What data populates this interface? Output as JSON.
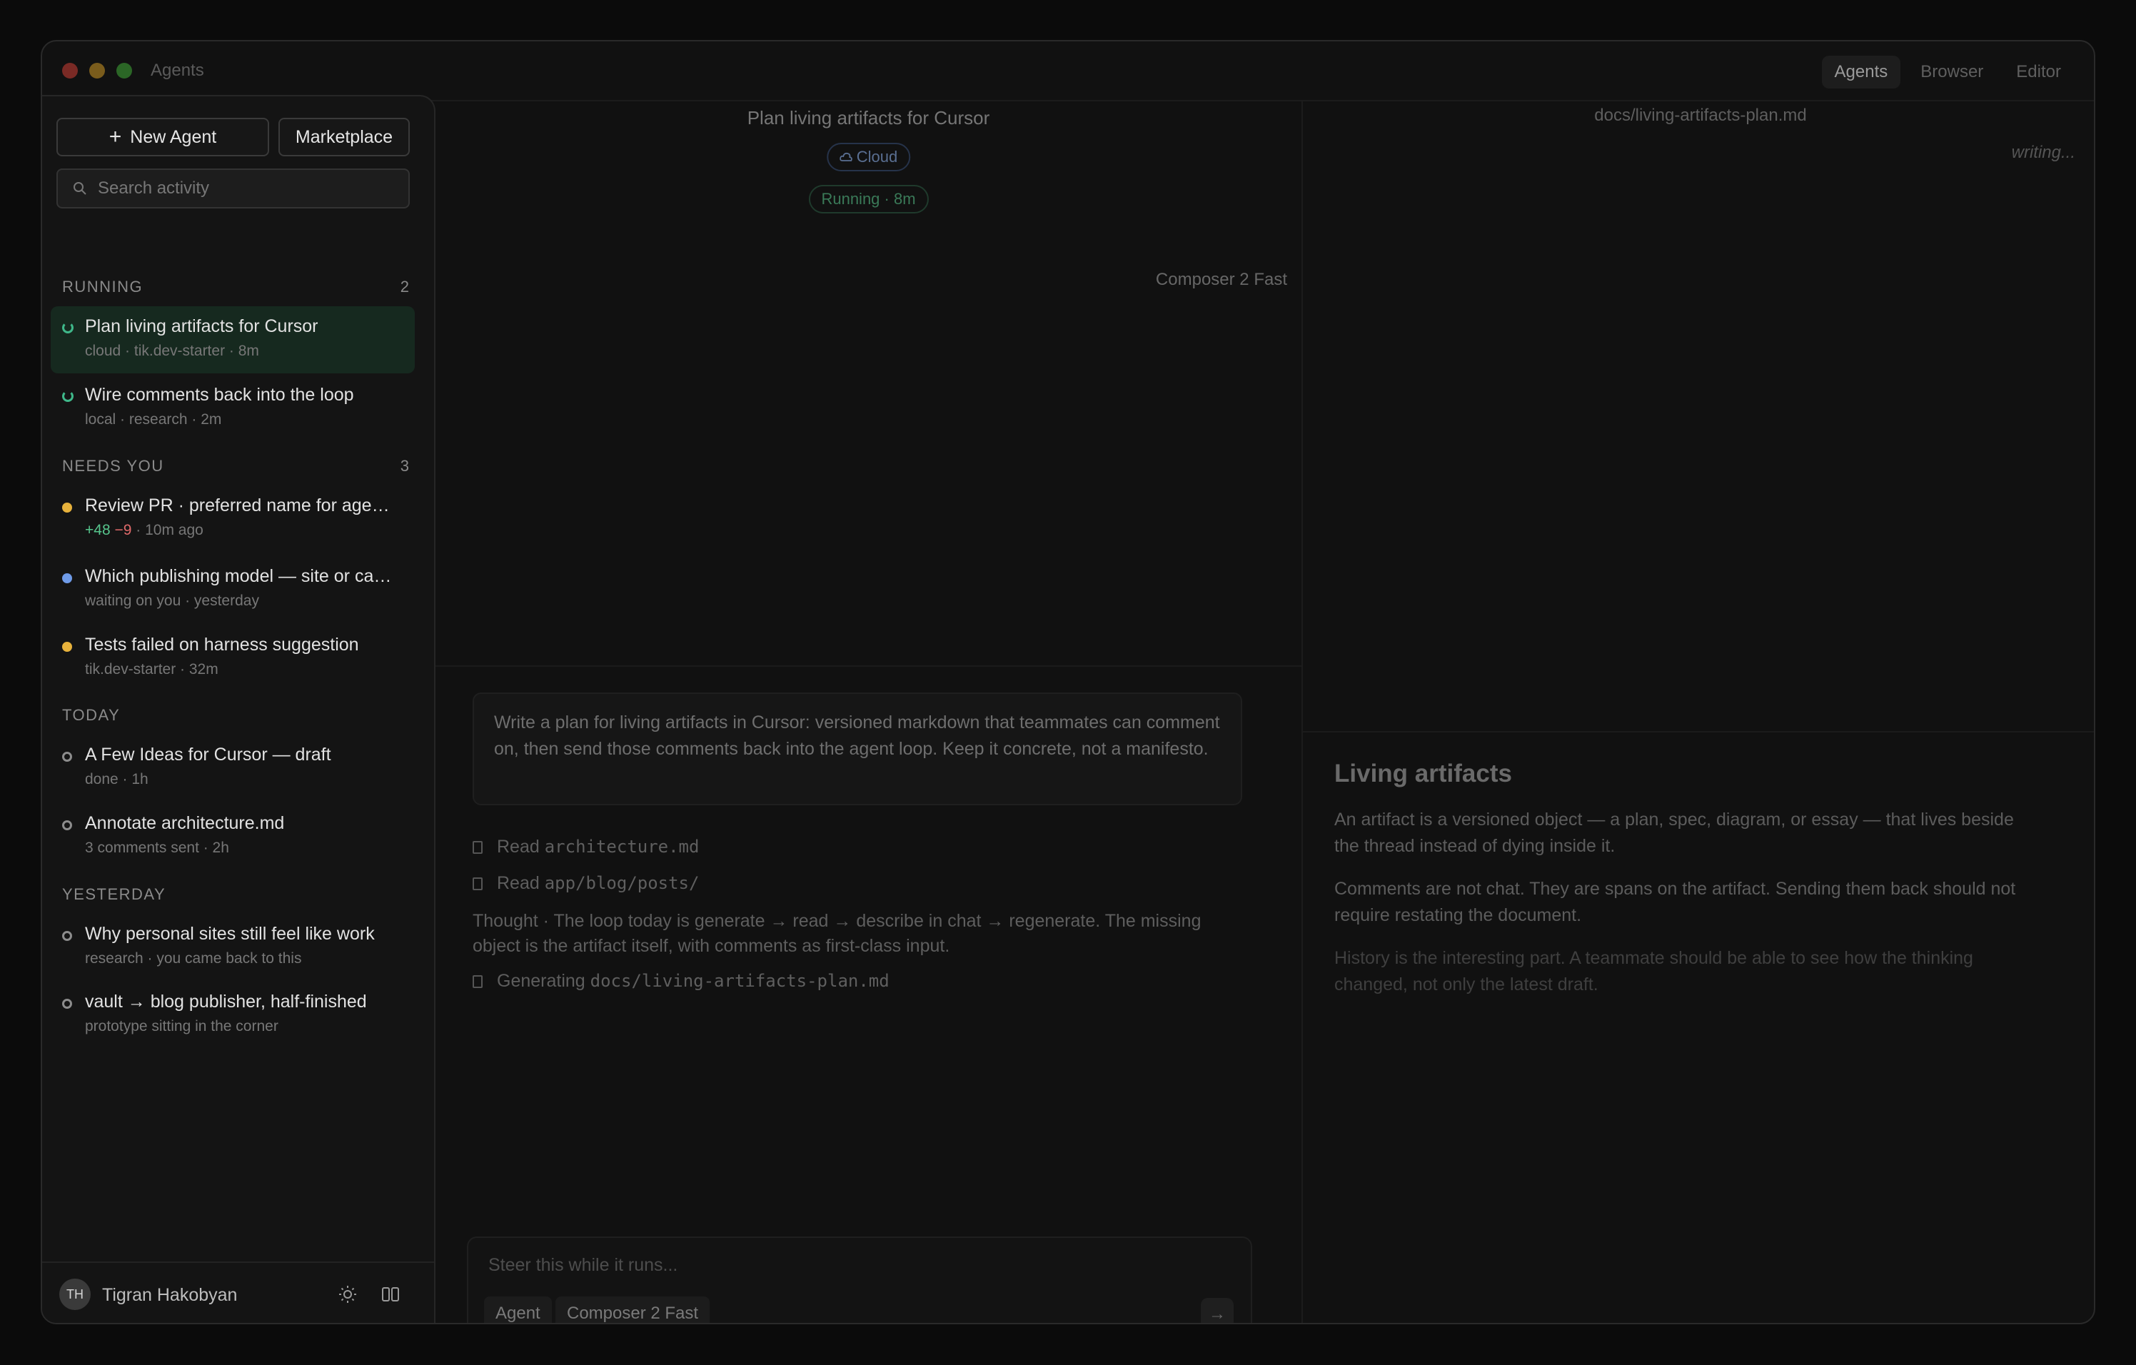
{
  "window": {
    "title": "Agents",
    "tabs": [
      "Agents",
      "Browser",
      "Editor"
    ],
    "active_tab": "Agents"
  },
  "sidebar": {
    "new_agent_label": "New Agent",
    "marketplace_label": "Marketplace",
    "search_placeholder": "Search activity",
    "sections": [
      {
        "label": "RUNNING",
        "count": "2",
        "items": [
          {
            "title": "Plan living artifacts for Cursor",
            "meta": "cloud · tik.dev-starter · 8m",
            "status": "running",
            "selected": true
          },
          {
            "title": "Wire comments back into the loop",
            "meta": "local · research · 2m",
            "status": "running"
          }
        ]
      },
      {
        "label": "NEEDS YOU",
        "count": "3",
        "items": [
          {
            "title": "Review PR · preferred name for age…",
            "meta_add": "+48",
            "meta_del": "−9",
            "meta": " · 10m ago",
            "status": "yellow"
          },
          {
            "title": "Which publishing model — site or ca…",
            "meta": "waiting on you · yesterday",
            "status": "blue"
          },
          {
            "title": "Tests failed on harness suggestion",
            "meta": "tik.dev-starter · 32m",
            "status": "yellow"
          }
        ]
      },
      {
        "label": "TODAY",
        "items": [
          {
            "title": "A Few Ideas for Cursor — draft",
            "meta": "done · 1h",
            "status": "ring"
          },
          {
            "title": "Annotate architecture.md",
            "meta": "3 comments sent · 2h",
            "status": "ring"
          }
        ]
      },
      {
        "label": "YESTERDAY",
        "items": [
          {
            "title": "Why personal sites still feel like work",
            "meta": "research · you came back to this",
            "status": "ring"
          },
          {
            "title": "vault → blog publisher, half-finished",
            "meta": "prototype sitting in the corner",
            "status": "ring"
          }
        ]
      }
    ],
    "user": {
      "initials": "TH",
      "name": "Tigran Hakobyan"
    }
  },
  "center": {
    "title": "Plan living artifacts for Cursor",
    "cloud_label": "Cloud",
    "running_label": "Running · 8m",
    "model_label": "Composer 2 Fast",
    "prompt": "Write a plan for living artifacts in Cursor: versioned markdown that teammates can comment on, then send those comments back into the agent loop. Keep it concrete, not a manifesto.",
    "log": [
      {
        "verb": "Read",
        "target": "architecture.md"
      },
      {
        "verb": "Read",
        "target": "app/blog/posts/"
      }
    ],
    "thought": "Thought · The loop today is generate → read → describe in chat → regenerate. The missing object is the artifact itself, with comments as first-class input.",
    "generating": {
      "verb": "Generating",
      "target": "docs/living-artifacts-plan.md"
    },
    "composer": {
      "placeholder": "Steer this while it runs...",
      "mode_chip": "Agent",
      "model_chip": "Composer 2 Fast",
      "send_glyph": "→"
    }
  },
  "right": {
    "path": "docs/living-artifacts-plan.md",
    "status": "writing...",
    "doc_title": "Living artifacts",
    "paragraphs": [
      "An artifact is a versioned object — a plan, spec, diagram, or essay — that lives beside the thread instead of dying inside it.",
      "Comments are not chat. They are spans on the artifact. Sending them back should not require restating the document.",
      "History is the interesting part. A teammate should be able to see how the thinking changed, not only the latest draft."
    ]
  },
  "colors": {
    "accent_green": "#3fb88a",
    "selected_bg": "#16291f",
    "needs_yellow": "#e7b23c",
    "needs_blue": "#6f9be8"
  },
  "icons": [
    "plus-icon",
    "search-icon",
    "spinner-icon",
    "status-dot-icon",
    "cloud-icon",
    "file-icon",
    "sun-icon",
    "layout-icon",
    "arrow-right-icon"
  ]
}
